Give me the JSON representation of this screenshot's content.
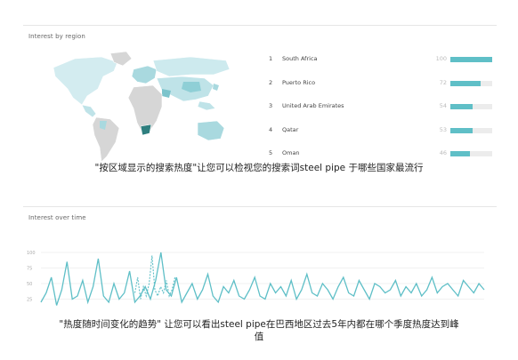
{
  "region_card": {
    "title": "Interest by region",
    "countries": [
      {
        "rank": "1",
        "name": "South Africa",
        "value": 100
      },
      {
        "rank": "2",
        "name": "Puerto Rico",
        "value": 72
      },
      {
        "rank": "3",
        "name": "United Arab Emirates",
        "value": 54
      },
      {
        "rank": "4",
        "name": "Qatar",
        "value": 53
      },
      {
        "rank": "5",
        "name": "Oman",
        "value": 46
      }
    ]
  },
  "caption_region": "\"按区域显示的搜索热度\"让您可以检视您的搜索词steel pipe 于哪些国家最流行",
  "time_card": {
    "title": "Interest over time"
  },
  "caption_time_line1": "\"热度随时间变化的趋势\" 让您可以看出steel pipe在巴西地区过去5年内都在哪个季度热度达到峰",
  "caption_time_line2": "值",
  "colors": {
    "accent": "#5fbfc7",
    "map_light": "#cdeaee",
    "map_grey": "#d6d6d6",
    "map_dark": "#2f7f7f"
  },
  "chart_data": {
    "type": "line",
    "title": "Interest over time",
    "yticks": [
      "100",
      "75",
      "50",
      "25"
    ],
    "ylim": [
      0,
      100
    ],
    "series": [
      {
        "values": [
          20,
          35,
          60,
          15,
          40,
          85,
          25,
          30,
          55,
          20,
          45,
          90,
          30,
          20,
          50,
          25,
          35,
          70,
          20,
          30,
          45,
          25,
          55,
          100,
          40,
          30,
          60,
          20,
          35,
          50,
          25,
          40,
          65,
          30,
          20,
          45,
          35,
          55,
          30,
          25,
          40,
          60,
          30,
          25,
          50,
          35,
          45,
          30,
          55,
          25,
          40,
          65,
          35,
          30,
          50,
          40,
          25,
          45,
          60,
          35,
          30,
          55,
          40,
          25,
          50,
          45,
          35,
          40,
          55,
          30,
          45,
          35,
          50,
          30,
          40,
          60,
          35,
          45,
          50,
          40,
          30,
          55,
          45,
          35,
          50,
          40
        ]
      },
      {
        "dashed": true,
        "values": [
          35,
          60,
          25,
          45,
          30,
          50,
          95,
          40,
          30,
          45,
          35,
          55,
          30,
          40,
          60
        ]
      }
    ]
  }
}
